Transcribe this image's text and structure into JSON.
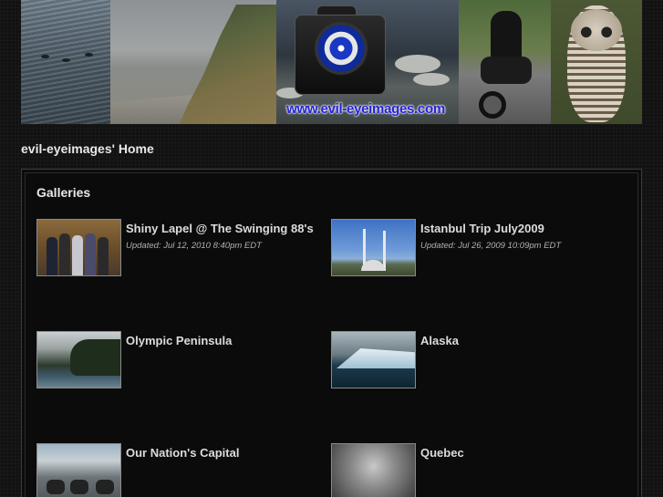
{
  "banner": {
    "url_text": "www.evil-eyeimages.com",
    "panels": [
      "sea-otters-photo",
      "coastal-cliff-photo",
      "camera-logo",
      "motorcycle-rider-photo",
      "barred-owl-photo"
    ]
  },
  "page_title": "evil-eyeimages' Home",
  "galleries_heading": "Galleries",
  "galleries": [
    {
      "title": "Shiny Lapel @ The Swinging 88's",
      "updated": "Updated: Jul 12, 2010 8:40pm EDT"
    },
    {
      "title": "Istanbul Trip July2009",
      "updated": "Updated: Jul 26, 2009 10:09pm EDT"
    },
    {
      "title": "Olympic Peninsula",
      "updated": ""
    },
    {
      "title": "Alaska",
      "updated": ""
    },
    {
      "title": "Our Nation's Capital",
      "updated": ""
    },
    {
      "title": "Quebec",
      "updated": ""
    }
  ],
  "colors": {
    "background": "#111111",
    "text": "#dcdcdc",
    "thumb_border": "#8a8a8a",
    "url_blue": "#2424d4"
  }
}
